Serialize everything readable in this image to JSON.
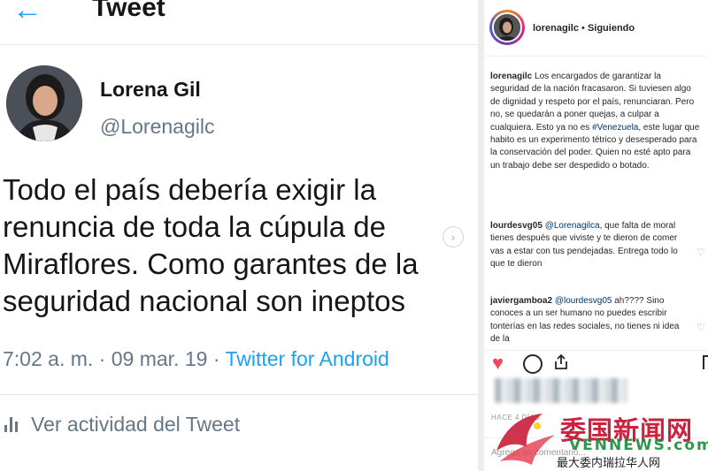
{
  "tweet": {
    "title": "Tweet",
    "author_name": "Lorena Gil",
    "author_handle": "@Lorenagilc",
    "text": "Todo el país debería exigir la renuncia de toda la cúpula de Miraflores. Como garantes de la seguridad nacional son ineptos",
    "time": "7:02 a. m.",
    "date": "09 mar. 19",
    "client": "Twitter for Android",
    "activity_label": "Ver actividad del Tweet"
  },
  "instagram": {
    "header_user": "lorenagilc",
    "header_follow": "Siguiendo",
    "caption_user": "lorenagilc",
    "caption_before": "Los encargados de garantizar la seguridad de la nación fracasaron. Si tuviesen algo de dignidad y respeto por el país, renunciaran. Pero no, se quedarán a poner quejas, a culpar a cualquiera. Esto ya no es ",
    "caption_hashtag": "#Venezuela",
    "caption_after": ", este lugar que habito es un experimento tétrico y desesperado para la conservación del poder. Quien no esté apto para un trabajo debe ser despedido o botado.",
    "comments": [
      {
        "user": "lourdesvg05",
        "mention": "@Lorenagilca",
        "text": ", que falta de moral tienes después que viviste y te dieron de comer vas a estar con tus pendejadas. Entrega todo lo que te dieron"
      },
      {
        "user": "javiergamboa2",
        "mention": "@lourdesvg05",
        "text": " ah???? Sino conoces a un ser humano no puedes escribir tonterías en las redes sociales, no tienes ni idea de la"
      }
    ],
    "time_label": "HACE 4 DÍAS",
    "comment_placeholder": "Agrega un comentario..."
  },
  "watermark": {
    "chinese": "委国新闻网",
    "latin": "VENNEWS.com",
    "tagline": "最大委内瑞拉华人网"
  },
  "colors": {
    "twitter_blue": "#1da1f2",
    "twitter_gray": "#657786",
    "instagram_like": "#ed4956",
    "watermark_red": "#c8102e",
    "watermark_green": "#1a8a3a"
  },
  "icons": [
    "back-arrow-icon",
    "share-icon",
    "activity-bars-icon",
    "heart-icon",
    "comment-icon",
    "share-icon",
    "bookmark-icon"
  ]
}
